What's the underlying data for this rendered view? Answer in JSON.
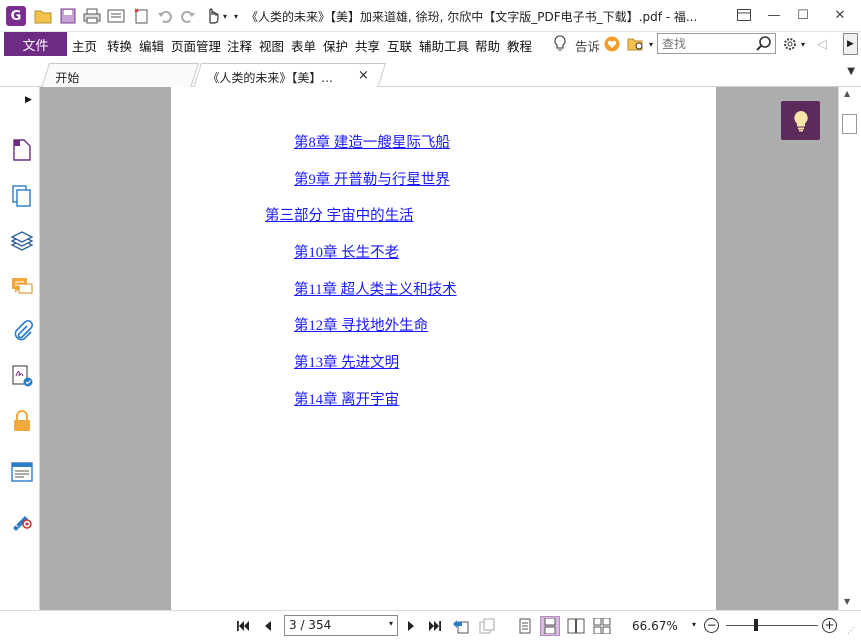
{
  "window": {
    "title": "《人类的未来》【美】加来道雄, 徐玢, 尔欣中【文字版_PDF电子书_下载】.pdf - 福...",
    "minimize_glyph": "—",
    "maximize_glyph": "☐",
    "close_glyph": "✕"
  },
  "menu": {
    "file": "文件",
    "items": [
      "主页",
      "转换",
      "编辑",
      "页面管理",
      "注释",
      "视图",
      "表单",
      "保护",
      "共享",
      "互联",
      "辅助工具",
      "帮助",
      "教程"
    ],
    "tell_me": "告诉",
    "search_placeholder": "查找"
  },
  "tabs": [
    {
      "label": "开始",
      "active": false
    },
    {
      "label": "《人类的未来》【美】...",
      "active": true,
      "close": "×"
    }
  ],
  "document": {
    "toc_entries": [
      {
        "text": "第8章 建造一艘星际飞船",
        "level": 2
      },
      {
        "text": "第9章 开普勒与行星世界",
        "level": 2
      },
      {
        "text": "第三部分 宇宙中的生活",
        "level": 1
      },
      {
        "text": "第10章 长生不老",
        "level": 2
      },
      {
        "text": "第11章 超人类主义和技术",
        "level": 2
      },
      {
        "text": "第12章 寻找地外生命",
        "level": 2
      },
      {
        "text": "第13章 先进文明",
        "level": 2
      },
      {
        "text": "第14章 离开宇宙",
        "level": 2
      }
    ]
  },
  "sidebar": {
    "icons": [
      "page-thumbnail-icon",
      "copy-pages-icon",
      "layers-icon",
      "comments-icon",
      "attachment-icon",
      "signature-icon",
      "security-lock-icon",
      "form-fields-icon",
      "certify-icon"
    ]
  },
  "status": {
    "page_current": "3",
    "page_total": "354",
    "page_text": "3 / 354",
    "zoom": "66.67%",
    "zoom_minus": "−",
    "zoom_plus": "+"
  },
  "colors": {
    "brand": "#6e2b83",
    "link": "#1a1aff",
    "doc_background": "#adadad"
  }
}
